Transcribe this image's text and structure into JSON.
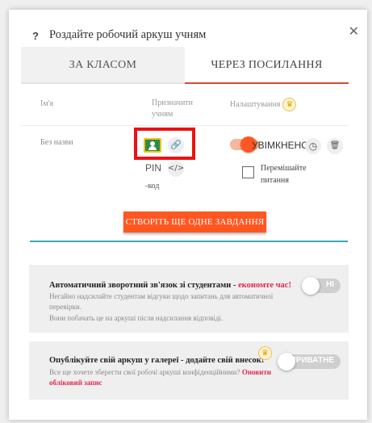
{
  "dialog": {
    "help_icon": "?",
    "title": "Роздайте робочий аркуш учням",
    "close_icon": "✕"
  },
  "tabs": [
    {
      "label": "ЗА КЛАСОМ",
      "active": false
    },
    {
      "label": "ЧЕРЕЗ ПОСИЛАННЯ",
      "active": true
    }
  ],
  "table": {
    "col_name": "Ім'я",
    "col_assign": "Призначити учням",
    "col_settings": "Налаштування",
    "premium_icon": "♛",
    "row": {
      "name": "Без назви",
      "link_icon": "🔗",
      "pin_label": "PIN",
      "embed_label": "</>",
      "pin_sub": "-код",
      "toggle_text": "УВІМКНЕНО",
      "timer_icon": "◷",
      "delete_icon": "🗑",
      "shuffle_label": "Перемішайте питання"
    }
  },
  "create_button": "СТВОРІТЬ ЩЕ ОДНЕ ЗАВДАННЯ",
  "feedback": {
    "title": "Автоматичний зворотний зв'язок зі студентами",
    "title_sep": " - ",
    "title_accent": "економте час!",
    "desc1": "Негайно надсилайте студентам відгуки щодо запитань для автоматичної перевірки.",
    "desc2": "Вони побачать це на аркуші після надсилання відповіді.",
    "toggle_label": "НІ"
  },
  "gallery": {
    "title": "Опублікуйте свій аркуш у галереї - додайте свій внесок!",
    "desc": "Все ще хочете зберегти свої робочі аркуші конфіденційними?",
    "link": "Оновити обліковий запис",
    "toggle_label": "ПРИВАТНЕ"
  },
  "colors": {
    "accent": "#ff5722",
    "tab_underline": "#d04a3a",
    "link_red": "#e0284c",
    "highlight": "#ee1111",
    "teal": "#3aa7b5"
  }
}
